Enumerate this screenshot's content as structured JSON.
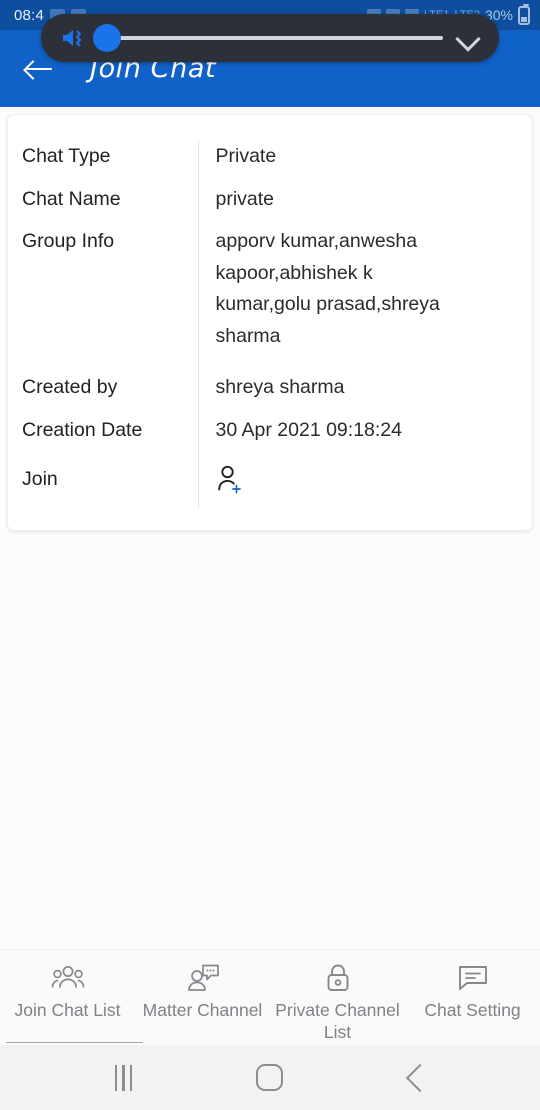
{
  "status_bar": {
    "clock": "08:4",
    "battery_percent": "30%",
    "left_icons": [
      "message-icon",
      "camera-icon"
    ],
    "right_icons": [
      "alarm-icon",
      "mute-icon",
      "wifi-icon",
      "signal-icon-1",
      "signal-icon-2"
    ],
    "right_text_1": "LTE1",
    "right_text_2": "LTE2",
    "background_color": "#0d4e9e"
  },
  "volume_overlay": {
    "mute_icon": "speaker-vibrate-mute-icon",
    "expand_icon": "chevron-down-icon",
    "slider_value": 0,
    "accent_color": "#1a73e8",
    "background_color": "#2c3038"
  },
  "appbar": {
    "back_icon": "arrow-left-icon",
    "title": "Join Chat",
    "background_color": "#1061c8"
  },
  "chat_details": {
    "rows": [
      {
        "label": "Chat Type",
        "value": "Private"
      },
      {
        "label": "Chat Name",
        "value": "private"
      },
      {
        "label": "Group Info",
        "value": "apporv kumar,anwesha kapoor,abhishek k kumar,golu prasad,shreya sharma"
      },
      {
        "label": "Created by",
        "value": "shreya sharma"
      },
      {
        "label": "Creation Date",
        "value": "30 Apr 2021 09:18:24"
      },
      {
        "label": "Join",
        "value": ""
      }
    ],
    "join_icon": "person-add-icon",
    "join_icon_accent": "#1a5fd0"
  },
  "tabbar": {
    "tabs": [
      {
        "label": "Join Chat List",
        "icon": "people-group-icon",
        "active": true
      },
      {
        "label": "Matter Channel",
        "icon": "person-chat-bubble-icon",
        "active": false
      },
      {
        "label": "Private Channel List",
        "icon": "lock-icon",
        "active": false
      },
      {
        "label": "Chat Setting",
        "icon": "chat-lines-icon",
        "active": false
      }
    ],
    "inactive_color": "#7e8287",
    "underline_color": "#9aa7b5"
  },
  "navbar": {
    "recents_icon": "recents-icon",
    "home_icon": "home-icon",
    "back_icon": "back-chevron-icon"
  }
}
